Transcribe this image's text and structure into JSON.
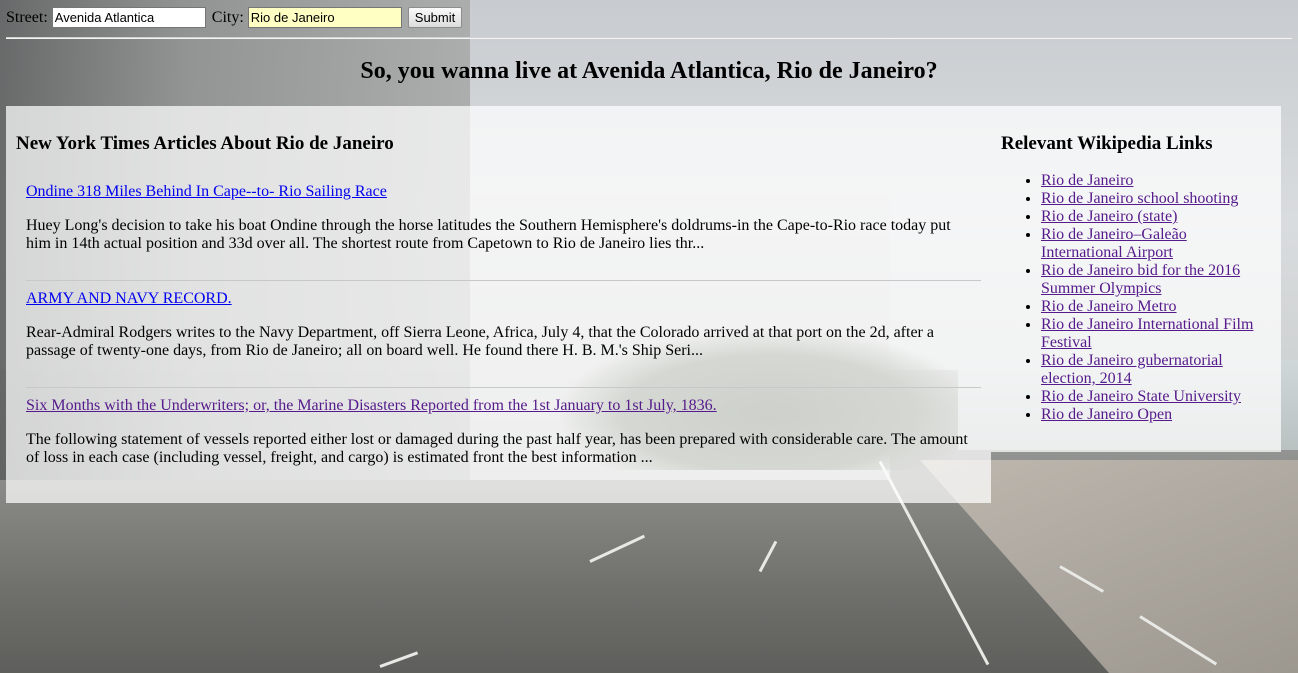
{
  "form": {
    "street_label": "Street:",
    "street_value": "Avenida Atlantica",
    "city_label": "City:",
    "city_value": "Rio de Janeiro",
    "submit_label": "Submit"
  },
  "headline": "So, you wanna live at Avenida Atlantica, Rio de Janeiro?",
  "nyt": {
    "heading": "New York Times Articles About Rio de Janeiro",
    "articles": [
      {
        "title": "Ondine 318 Miles Behind In Cape--to- Rio Sailing Race",
        "snippet": "Huey Long's decision to take his boat Ondine through the horse latitudes the Southern Hemisphere's doldrums-in the Cape-to-Rio race today put him in 14th actual position and 33d over all. The shortest route from Capetown to Rio de Janeiro lies thr..."
      },
      {
        "title": "ARMY AND NAVY RECORD.",
        "snippet": "Rear-Admiral Rodgers writes to the Navy Department, off Sierra Leone, Africa, July 4, that the Colorado arrived at that port on the 2d, after a passage of twenty-one days, from Rio de Janeiro; all on board well. He found there H. B. M.'s Ship Seri..."
      },
      {
        "title": "Six Months with the Underwriters; or, the Marine Disasters Reported from the 1st January to 1st July, 1836.",
        "snippet": "The following statement of vessels reported either lost or damaged during the past half year, has been prepared with considerable care. The amount of loss in each case (including vessel, freight, and cargo) is estimated front the best information ..."
      }
    ]
  },
  "wiki": {
    "heading": "Relevant Wikipedia Links",
    "links": [
      "Rio de Janeiro",
      "Rio de Janeiro school shooting",
      "Rio de Janeiro (state)",
      "Rio de Janeiro–Galeão International Airport",
      "Rio de Janeiro bid for the 2016 Summer Olympics",
      "Rio de Janeiro Metro",
      "Rio de Janeiro International Film Festival",
      "Rio de Janeiro gubernatorial election, 2014",
      "Rio de Janeiro State University",
      "Rio de Janeiro Open"
    ]
  }
}
